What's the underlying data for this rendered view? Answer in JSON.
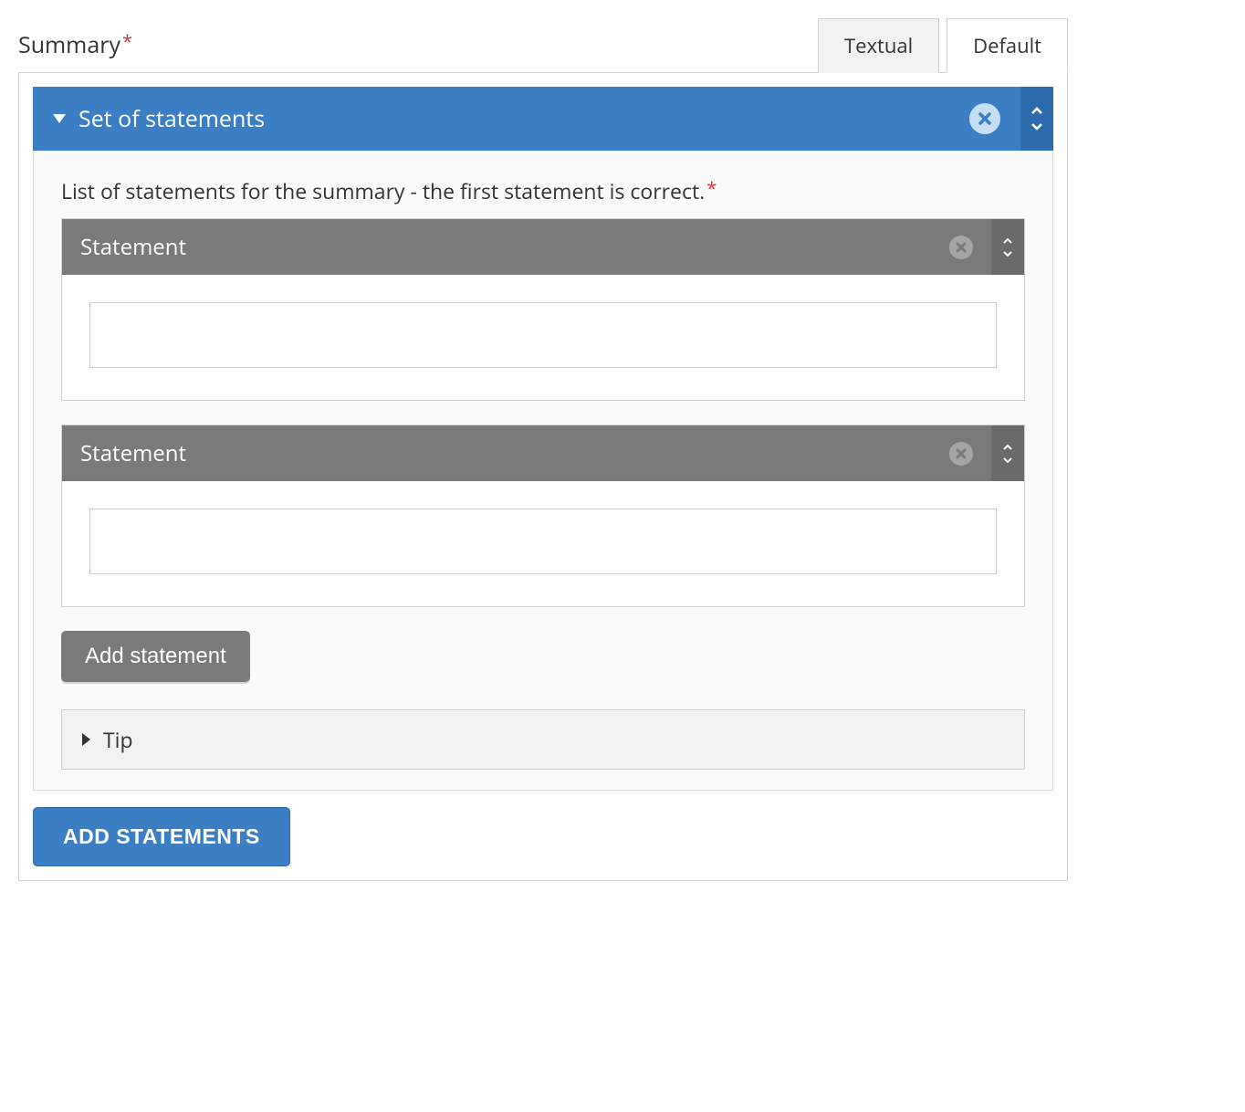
{
  "section_label": "Summary",
  "tabs": {
    "textual": "Textual",
    "default": "Default"
  },
  "set_block": {
    "title": "Set of statements",
    "list_label": "List of statements for the summary - the first statement is correct.",
    "statements": [
      {
        "title": "Statement",
        "value": ""
      },
      {
        "title": "Statement",
        "value": ""
      }
    ],
    "add_statement_label": "Add statement",
    "tip_label": "Tip"
  },
  "add_statements_button": "ADD STATEMENTS"
}
